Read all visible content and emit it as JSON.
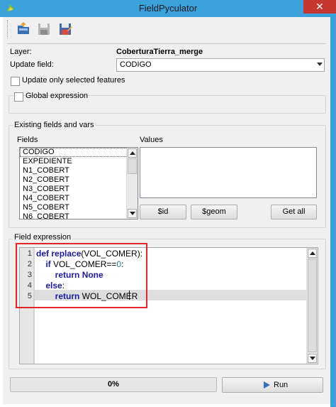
{
  "window": {
    "title": "FieldPyculator",
    "close_glyph": "✕"
  },
  "toolbar": {
    "buttons": [
      {
        "icon": "open-file-icon"
      },
      {
        "icon": "save-icon"
      },
      {
        "icon": "save-as-icon"
      }
    ]
  },
  "form": {
    "layer_label": "Layer:",
    "layer_value": "CoberturaTierra_merge",
    "update_field_label": "Update field:",
    "update_field_value": "CODIGO",
    "update_selected_label": "Update only selected features",
    "global_expression_label": "Global expression"
  },
  "existing": {
    "title": "Existing fields and vars",
    "fields_label": "Fields",
    "values_label": "Values",
    "fields": [
      "CODIGO",
      "EXPEDIENTE",
      "N1_COBERT",
      "N2_COBERT",
      "N3_COBERT",
      "N4_COBERT",
      "N5_COBERT",
      "N6_COBERT"
    ],
    "buttons": {
      "id": "$id",
      "geom": "$geom",
      "get_all": "Get all"
    }
  },
  "expression": {
    "title": "Field expression",
    "line_numbers": [
      "1",
      "2",
      "3",
      "4",
      "5"
    ],
    "lines": [
      {
        "indent": "",
        "tokens": [
          {
            "t": "def",
            "k": "kw"
          },
          {
            "t": " ",
            "k": ""
          },
          {
            "t": "replace",
            "k": "kw"
          },
          {
            "t": "(VOL_COMER):",
            "k": ""
          }
        ]
      },
      {
        "indent": "    ",
        "tokens": [
          {
            "t": "if",
            "k": "kw"
          },
          {
            "t": " VOL_COMER==",
            "k": ""
          },
          {
            "t": "0",
            "k": "num"
          },
          {
            "t": ":",
            "k": ""
          }
        ]
      },
      {
        "indent": "        ",
        "tokens": [
          {
            "t": "return",
            "k": "kw"
          },
          {
            "t": " ",
            "k": ""
          },
          {
            "t": "None",
            "k": "kw"
          }
        ]
      },
      {
        "indent": "    ",
        "tokens": [
          {
            "t": "else",
            "k": "kw"
          },
          {
            "t": ":",
            "k": ""
          }
        ]
      },
      {
        "indent": "        ",
        "tokens": [
          {
            "t": "return",
            "k": "kw"
          },
          {
            "t": " WOL_COMER",
            "k": ""
          }
        ]
      }
    ],
    "highlight_color": "#e3242b"
  },
  "progress": {
    "value": 0,
    "label": "0%"
  },
  "run": {
    "label": "Run",
    "icon": "play-icon"
  },
  "colors": {
    "titlebar": "#3ba1db",
    "close": "#c7372f",
    "keyword": "#1a1aa6",
    "number": "#1c8c8c"
  }
}
